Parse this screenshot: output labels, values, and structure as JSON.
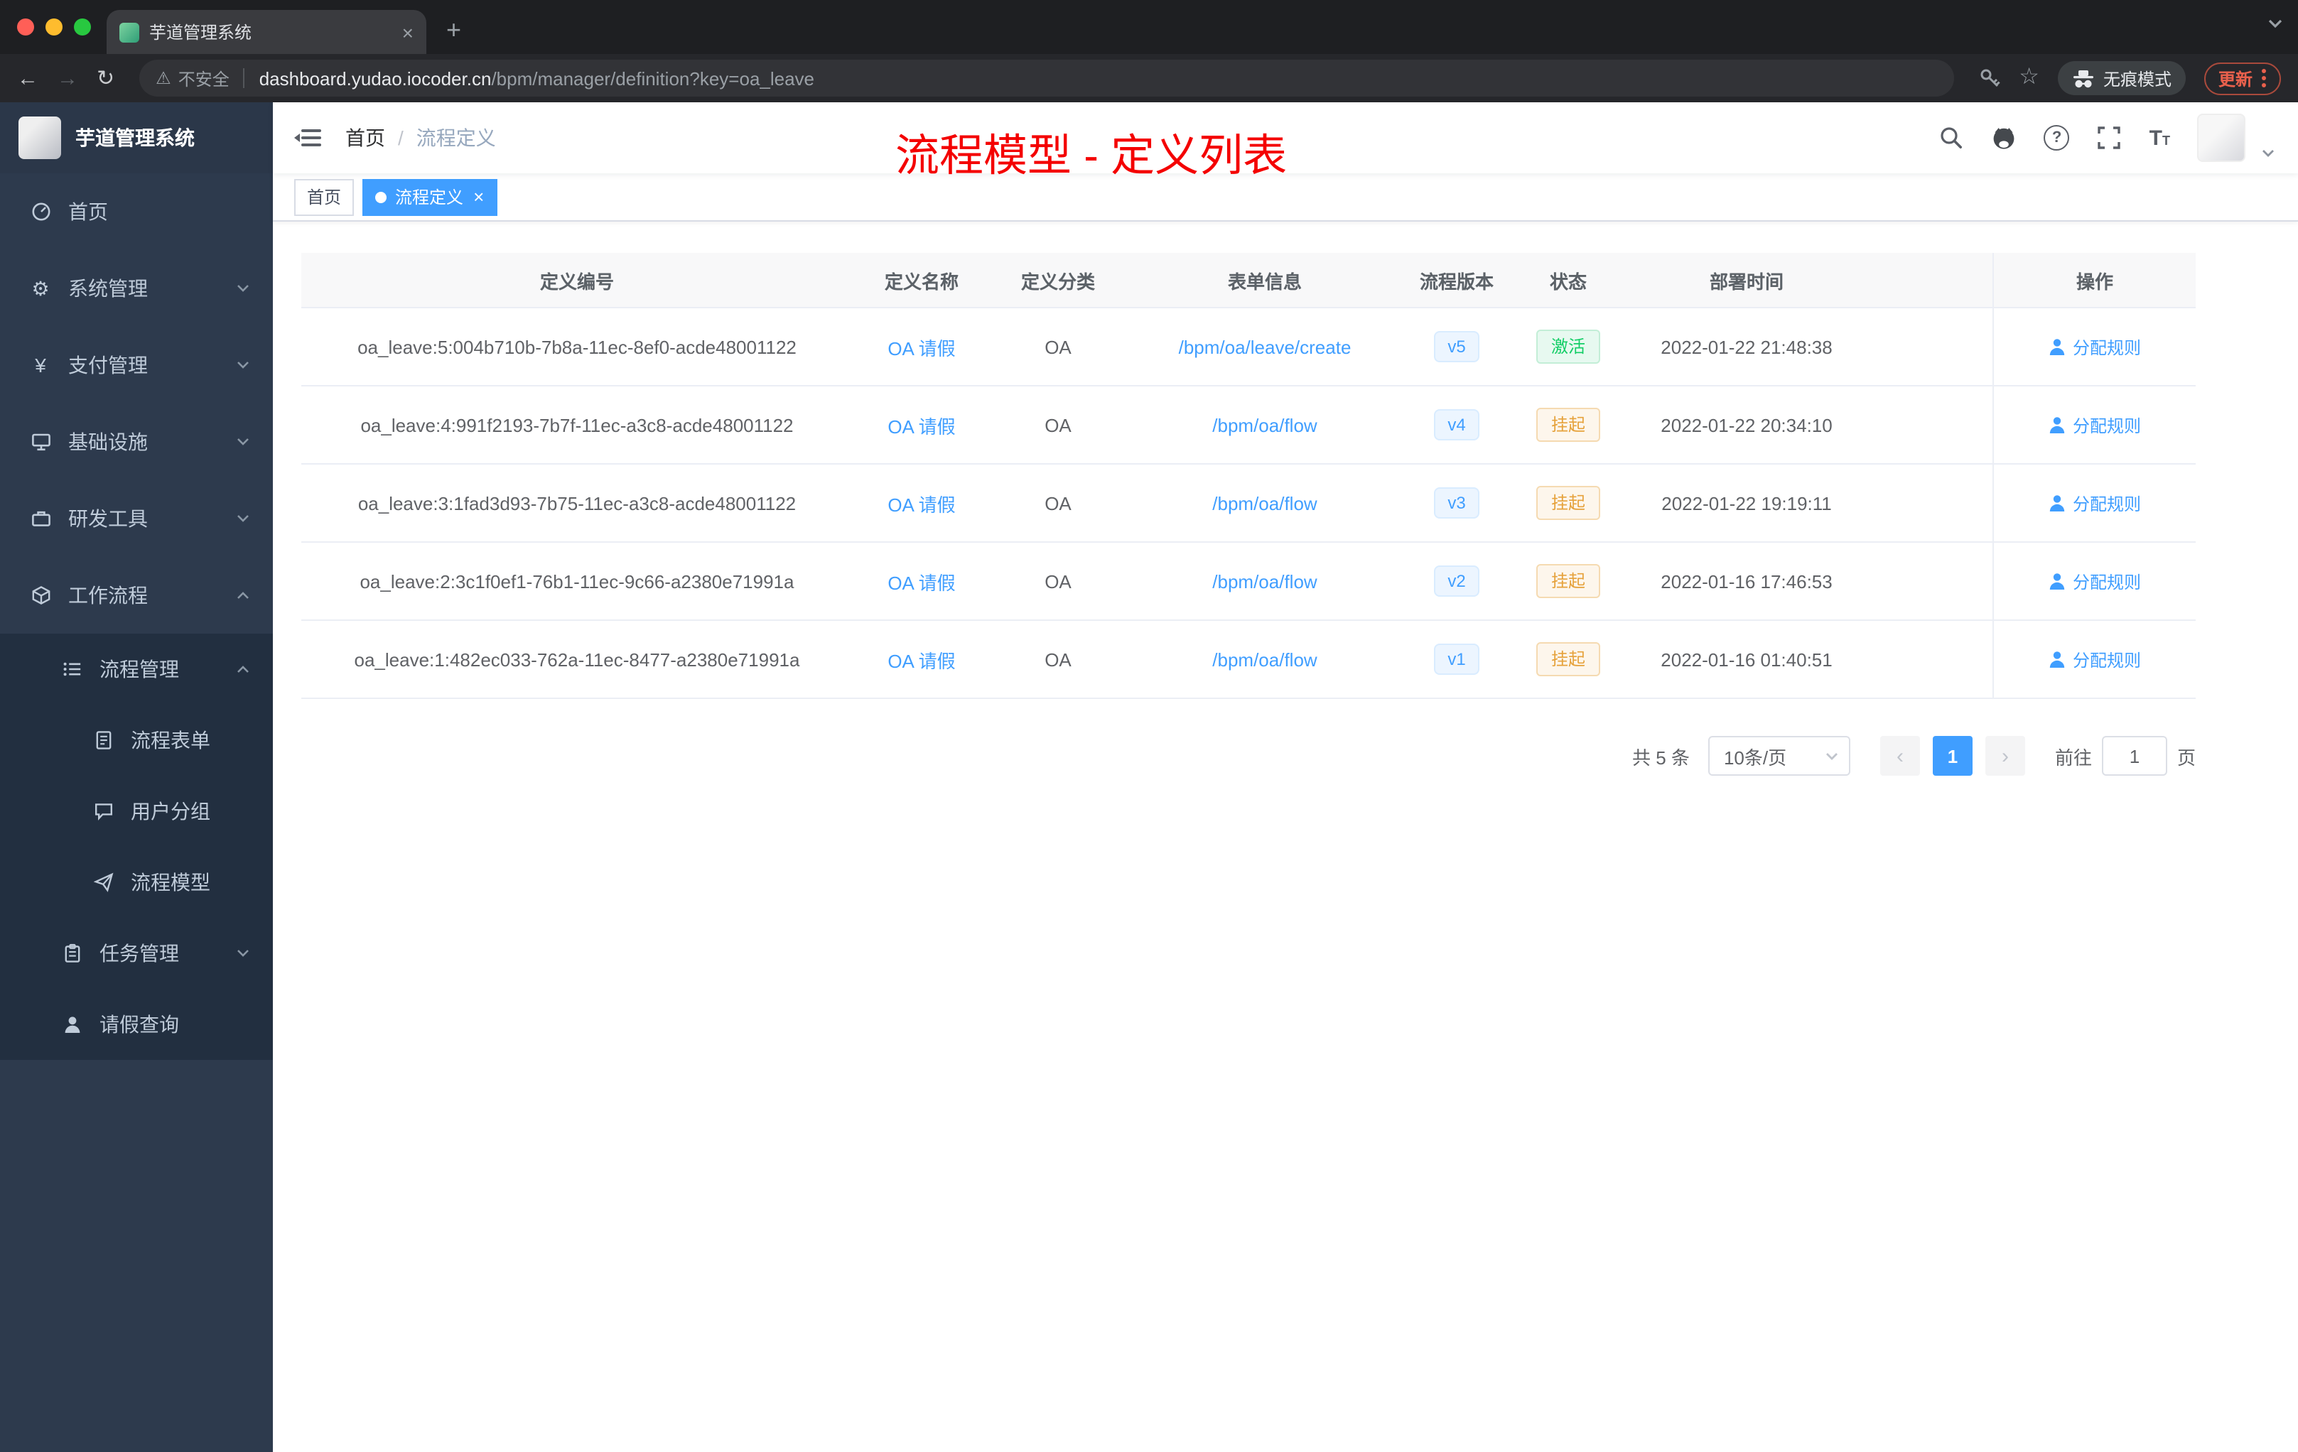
{
  "browser": {
    "tab": {
      "title": "芋道管理系统",
      "close": "×",
      "new_tab": "+"
    },
    "security_label": "不安全",
    "url_domain": "dashboard.yudao.iocoder.cn",
    "url_path": "/bpm/manager/definition?key=oa_leave",
    "incognito_label": "无痕模式",
    "update_label": "更新"
  },
  "header": {
    "logo_title": "芋道管理系统",
    "breadcrumb_home": "首页",
    "breadcrumb_separator": "/",
    "breadcrumb_current": "流程定义",
    "annotation": "流程模型 - 定义列表"
  },
  "tags": [
    {
      "label": "首页"
    },
    {
      "label": "流程定义",
      "close": "×"
    }
  ],
  "sidebar": {
    "items": [
      {
        "label": "首页"
      },
      {
        "label": "系统管理"
      },
      {
        "label": "支付管理"
      },
      {
        "label": "基础设施"
      },
      {
        "label": "研发工具"
      },
      {
        "label": "工作流程"
      },
      {
        "label": "流程管理"
      },
      {
        "label": "流程表单"
      },
      {
        "label": "用户分组"
      },
      {
        "label": "流程模型"
      },
      {
        "label": "任务管理"
      },
      {
        "label": "请假查询"
      }
    ]
  },
  "table": {
    "columns": [
      "定义编号",
      "定义名称",
      "定义分类",
      "表单信息",
      "流程版本",
      "状态",
      "部署时间",
      "操作"
    ],
    "rows": [
      {
        "id": "oa_leave:5:004b710b-7b8a-11ec-8ef0-acde48001122",
        "name": "OA 请假",
        "category": "OA",
        "form": "/bpm/oa/leave/create",
        "version": "v5",
        "status": "激活",
        "status_type": "success",
        "time": "2022-01-22 21:48:38",
        "action": "分配规则"
      },
      {
        "id": "oa_leave:4:991f2193-7b7f-11ec-a3c8-acde48001122",
        "name": "OA 请假",
        "category": "OA",
        "form": "/bpm/oa/flow",
        "version": "v4",
        "status": "挂起",
        "status_type": "warning",
        "time": "2022-01-22 20:34:10",
        "action": "分配规则"
      },
      {
        "id": "oa_leave:3:1fad3d93-7b75-11ec-a3c8-acde48001122",
        "name": "OA 请假",
        "category": "OA",
        "form": "/bpm/oa/flow",
        "version": "v3",
        "status": "挂起",
        "status_type": "warning",
        "time": "2022-01-22 19:19:11",
        "action": "分配规则"
      },
      {
        "id": "oa_leave:2:3c1f0ef1-76b1-11ec-9c66-a2380e71991a",
        "name": "OA 请假",
        "category": "OA",
        "form": "/bpm/oa/flow",
        "version": "v2",
        "status": "挂起",
        "status_type": "warning",
        "time": "2022-01-16 17:46:53",
        "action": "分配规则"
      },
      {
        "id": "oa_leave:1:482ec033-762a-11ec-8477-a2380e71991a",
        "name": "OA 请假",
        "category": "OA",
        "form": "/bpm/oa/flow",
        "version": "v1",
        "status": "挂起",
        "status_type": "warning",
        "time": "2022-01-16 01:40:51",
        "action": "分配规则"
      }
    ]
  },
  "pagination": {
    "total": "共 5 条",
    "page_size": "10条/页",
    "prev": "‹",
    "page": "1",
    "next": "›",
    "goto_label": "前往",
    "goto_value": "1",
    "goto_unit": "页"
  },
  "colors": {
    "accent": "#409eff",
    "success": "#13ce66",
    "warning": "#e6a23c",
    "annotation_red": "#f40000",
    "sidebar_bg": "#2d3a4d",
    "submenu_bg": "#222f40"
  }
}
